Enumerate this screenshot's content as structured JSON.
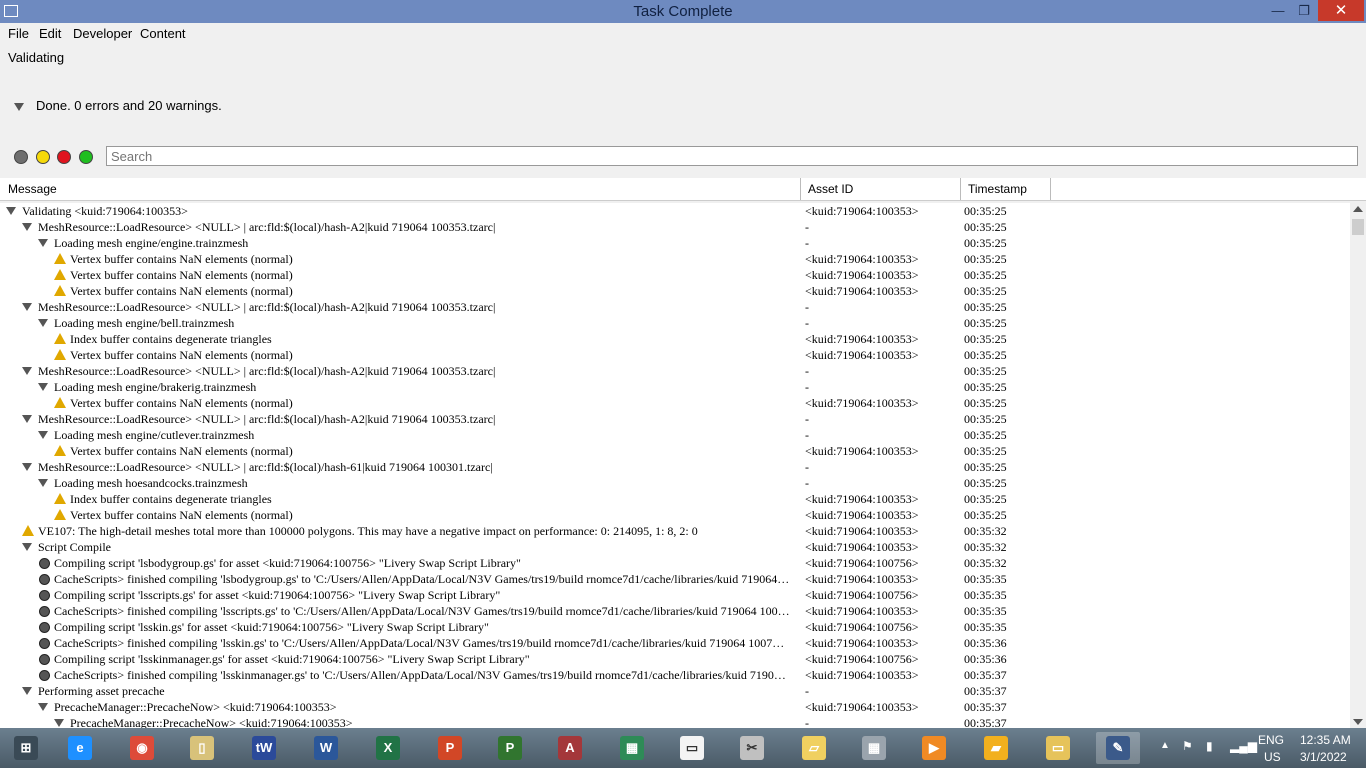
{
  "window": {
    "title": "Task Complete",
    "min_glyph": "—",
    "max_glyph": "❐",
    "close_glyph": "✕"
  },
  "menu": [
    "File",
    "Edit",
    "Developer",
    "Content"
  ],
  "status_label": "Validating",
  "summary": "Done. 0 errors and 20 warnings.",
  "filter_dots": [
    {
      "name": "all",
      "color": "#6e6e6e"
    },
    {
      "name": "warnings",
      "color": "#f5d90a"
    },
    {
      "name": "errors",
      "color": "#e0141e"
    },
    {
      "name": "ok",
      "color": "#1fbe1f"
    }
  ],
  "search": {
    "placeholder": "Search"
  },
  "columns": {
    "message": "Message",
    "asset_id": "Asset ID",
    "timestamp": "Timestamp"
  },
  "rows": [
    {
      "level": 0,
      "icon": "expander",
      "msg": "Validating <kuid:719064:100353>",
      "aid": "<kuid:719064:100353>",
      "ts": "00:35:25"
    },
    {
      "level": 1,
      "icon": "expander",
      "msg": "MeshResource::LoadResource> <NULL> | arc:fld:$(local)/hash-A2|kuid 719064 100353.tzarc|",
      "aid": "-",
      "ts": "00:35:25"
    },
    {
      "level": 2,
      "icon": "expander",
      "msg": "Loading mesh engine/engine.trainzmesh",
      "aid": "-",
      "ts": "00:35:25"
    },
    {
      "level": 3,
      "icon": "warning",
      "msg": "Vertex buffer contains NaN elements (normal)",
      "aid": "<kuid:719064:100353>",
      "ts": "00:35:25"
    },
    {
      "level": 3,
      "icon": "warning",
      "msg": "Vertex buffer contains NaN elements (normal)",
      "aid": "<kuid:719064:100353>",
      "ts": "00:35:25"
    },
    {
      "level": 3,
      "icon": "warning",
      "msg": "Vertex buffer contains NaN elements (normal)",
      "aid": "<kuid:719064:100353>",
      "ts": "00:35:25"
    },
    {
      "level": 1,
      "icon": "expander",
      "msg": "MeshResource::LoadResource> <NULL> | arc:fld:$(local)/hash-A2|kuid 719064 100353.tzarc|",
      "aid": "-",
      "ts": "00:35:25"
    },
    {
      "level": 2,
      "icon": "expander",
      "msg": "Loading mesh engine/bell.trainzmesh",
      "aid": "-",
      "ts": "00:35:25"
    },
    {
      "level": 3,
      "icon": "warning",
      "msg": "Index buffer contains degenerate triangles",
      "aid": "<kuid:719064:100353>",
      "ts": "00:35:25"
    },
    {
      "level": 3,
      "icon": "warning",
      "msg": "Vertex buffer contains NaN elements (normal)",
      "aid": "<kuid:719064:100353>",
      "ts": "00:35:25"
    },
    {
      "level": 1,
      "icon": "expander",
      "msg": "MeshResource::LoadResource> <NULL> | arc:fld:$(local)/hash-A2|kuid 719064 100353.tzarc|",
      "aid": "-",
      "ts": "00:35:25"
    },
    {
      "level": 2,
      "icon": "expander",
      "msg": "Loading mesh engine/brakerig.trainzmesh",
      "aid": "-",
      "ts": "00:35:25"
    },
    {
      "level": 3,
      "icon": "warning",
      "msg": "Vertex buffer contains NaN elements (normal)",
      "aid": "<kuid:719064:100353>",
      "ts": "00:35:25"
    },
    {
      "level": 1,
      "icon": "expander",
      "msg": "MeshResource::LoadResource> <NULL> | arc:fld:$(local)/hash-A2|kuid 719064 100353.tzarc|",
      "aid": "-",
      "ts": "00:35:25"
    },
    {
      "level": 2,
      "icon": "expander",
      "msg": "Loading mesh engine/cutlever.trainzmesh",
      "aid": "-",
      "ts": "00:35:25"
    },
    {
      "level": 3,
      "icon": "warning",
      "msg": "Vertex buffer contains NaN elements (normal)",
      "aid": "<kuid:719064:100353>",
      "ts": "00:35:25"
    },
    {
      "level": 1,
      "icon": "expander",
      "msg": "MeshResource::LoadResource> <NULL> | arc:fld:$(local)/hash-61|kuid 719064 100301.tzarc|",
      "aid": "-",
      "ts": "00:35:25"
    },
    {
      "level": 2,
      "icon": "expander",
      "msg": "Loading mesh hoesandcocks.trainzmesh",
      "aid": "-",
      "ts": "00:35:25"
    },
    {
      "level": 3,
      "icon": "warning",
      "msg": "Index buffer contains degenerate triangles",
      "aid": "<kuid:719064:100353>",
      "ts": "00:35:25"
    },
    {
      "level": 3,
      "icon": "warning",
      "msg": "Vertex buffer contains NaN elements (normal)",
      "aid": "<kuid:719064:100353>",
      "ts": "00:35:25"
    },
    {
      "level": 1,
      "icon": "warning",
      "msg": "VE107: The high-detail meshes total more than 100000 polygons. This may have a negative impact on performance: 0: 214095, 1: 8, 2: 0",
      "aid": "<kuid:719064:100353>",
      "ts": "00:35:32"
    },
    {
      "level": 1,
      "icon": "expander",
      "msg": "Script Compile",
      "aid": "<kuid:719064:100353>",
      "ts": "00:35:32"
    },
    {
      "level": 2,
      "icon": "info",
      "msg": "Compiling script 'lsbodygroup.gs' for asset <kuid:719064:100756> \"Livery Swap Script Library\"",
      "aid": "<kuid:719064:100756>",
      "ts": "00:35:32"
    },
    {
      "level": 2,
      "icon": "info",
      "msg": "CacheScripts> finished compiling 'lsbodygroup.gs' to 'C:/Users/Allen/AppData/Local/N3V Games/trs19/build rnomce7d1/cache/libraries/kuid 719064 1...",
      "aid": "<kuid:719064:100353>",
      "ts": "00:35:35"
    },
    {
      "level": 2,
      "icon": "info",
      "msg": "Compiling script 'lsscripts.gs' for asset <kuid:719064:100756> \"Livery Swap Script Library\"",
      "aid": "<kuid:719064:100756>",
      "ts": "00:35:35"
    },
    {
      "level": 2,
      "icon": "info",
      "msg": "CacheScripts> finished compiling 'lsscripts.gs' to 'C:/Users/Allen/AppData/Local/N3V Games/trs19/build rnomce7d1/cache/libraries/kuid 719064 1007...",
      "aid": "<kuid:719064:100353>",
      "ts": "00:35:35"
    },
    {
      "level": 2,
      "icon": "info",
      "msg": "Compiling script 'lsskin.gs' for asset <kuid:719064:100756> \"Livery Swap Script Library\"",
      "aid": "<kuid:719064:100756>",
      "ts": "00:35:35"
    },
    {
      "level": 2,
      "icon": "info",
      "msg": "CacheScripts> finished compiling 'lsskin.gs' to 'C:/Users/Allen/AppData/Local/N3V Games/trs19/build rnomce7d1/cache/libraries/kuid 719064 100756/...",
      "aid": "<kuid:719064:100353>",
      "ts": "00:35:36"
    },
    {
      "level": 2,
      "icon": "info",
      "msg": "Compiling script 'lsskinmanager.gs' for asset <kuid:719064:100756> \"Livery Swap Script Library\"",
      "aid": "<kuid:719064:100756>",
      "ts": "00:35:36"
    },
    {
      "level": 2,
      "icon": "info",
      "msg": "CacheScripts> finished compiling 'lsskinmanager.gs' to 'C:/Users/Allen/AppData/Local/N3V Games/trs19/build rnomce7d1/cache/libraries/kuid 719064 ...",
      "aid": "<kuid:719064:100353>",
      "ts": "00:35:37"
    },
    {
      "level": 1,
      "icon": "expander",
      "msg": "Performing asset precache",
      "aid": "-",
      "ts": "00:35:37"
    },
    {
      "level": 2,
      "icon": "expander",
      "msg": "PrecacheManager::PrecacheNow> <kuid:719064:100353>",
      "aid": "<kuid:719064:100353>",
      "ts": "00:35:37"
    },
    {
      "level": 3,
      "icon": "expander",
      "msg": "PrecacheManager::PrecacheNow> <kuid:719064:100353>",
      "aid": "-",
      "ts": "00:35:37"
    }
  ],
  "taskbar": {
    "apps": [
      {
        "name": "start",
        "glyph": "⊞",
        "color": "#3a4a56"
      },
      {
        "name": "internet-explorer",
        "glyph": "e",
        "color": "#1e90ff"
      },
      {
        "name": "chrome",
        "glyph": "◉",
        "color": "#dd4b39"
      },
      {
        "name": "file-explorer",
        "glyph": "▯",
        "color": "#d8c27a"
      },
      {
        "name": "tw",
        "glyph": "tW",
        "color": "#2b4a9a"
      },
      {
        "name": "word",
        "glyph": "W",
        "color": "#2b579a"
      },
      {
        "name": "excel",
        "glyph": "X",
        "color": "#217346"
      },
      {
        "name": "powerpoint",
        "glyph": "P",
        "color": "#d24726"
      },
      {
        "name": "project",
        "glyph": "P",
        "color": "#31752f"
      },
      {
        "name": "access",
        "glyph": "A",
        "color": "#a4373a"
      },
      {
        "name": "map-app",
        "glyph": "▦",
        "color": "#2e8b57"
      },
      {
        "name": "notepad",
        "glyph": "▭",
        "color": "#f4f4f4"
      },
      {
        "name": "snipping",
        "glyph": "✂",
        "color": "#c0c0c0"
      },
      {
        "name": "folder-mail",
        "glyph": "▱",
        "color": "#f0d060"
      },
      {
        "name": "calculator",
        "glyph": "▦",
        "color": "#9aa4ad"
      },
      {
        "name": "media-player",
        "glyph": "▶",
        "color": "#f08a24"
      },
      {
        "name": "trainz",
        "glyph": "▰",
        "color": "#f2b01e"
      },
      {
        "name": "folder",
        "glyph": "▭",
        "color": "#e6c35a"
      },
      {
        "name": "content-manager",
        "glyph": "✎",
        "color": "#3b5a8a"
      }
    ],
    "tray": {
      "lang": "ENG",
      "region": "US",
      "time": "12:35 AM",
      "date": "3/1/2022"
    }
  }
}
